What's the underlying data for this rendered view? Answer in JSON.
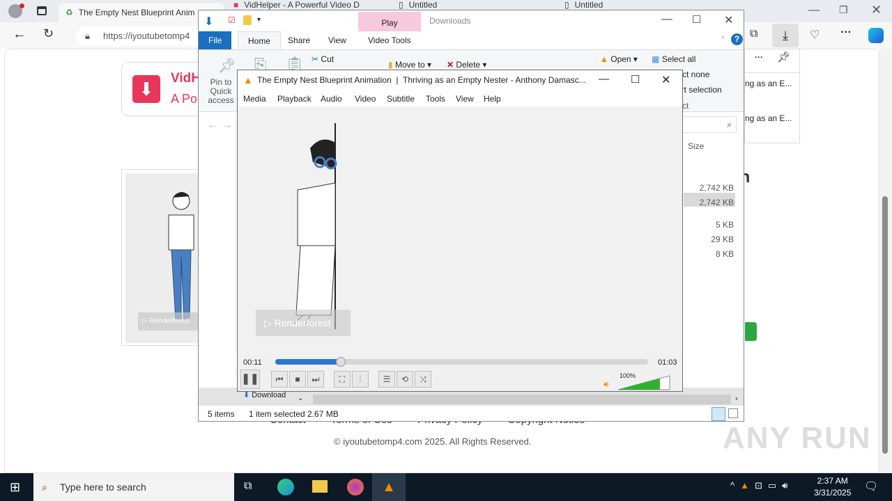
{
  "browser": {
    "tabs": [
      {
        "title": "The Empty Nest Blueprint Anim",
        "active": true
      },
      {
        "title": "VidHelper - A Powerful Video D",
        "active": false
      },
      {
        "title": "Untitled",
        "active": false
      },
      {
        "title": "Untitled",
        "active": false
      }
    ],
    "url": "https://iyoutubetomp4",
    "downloads_flyout": {
      "items": [
        "ng as an E...",
        "ng as an E..."
      ]
    }
  },
  "website": {
    "brand_title": "VidH",
    "brand_subtitle": "A Po",
    "heading_fragment": "on",
    "watermark_text": "Renderforest",
    "footer_links": [
      "Contact",
      "Terms of Use",
      "Privacy Policy",
      "Copyright Notice"
    ],
    "copyright": "© iyoutubetomp4.com 2025. All Rights Reserved."
  },
  "explorer": {
    "title": "Downloads",
    "context_tab": "Play",
    "tabs": [
      "File",
      "Home",
      "Share",
      "View",
      "Video Tools"
    ],
    "ribbon": {
      "pin": "Pin to Quick access",
      "cut": "Cut",
      "move_to": "Move to",
      "delete": "Delete",
      "open": "Open",
      "select_all": "Select all",
      "select_none": "Select none",
      "invert_selection": "Invert selection",
      "select": "Select"
    },
    "column_size": "Size",
    "sizes": [
      "2,742 KB",
      "2,742 KB",
      "5 KB",
      "29 KB",
      "8 KB"
    ],
    "nav_item": "Download",
    "status_items": "5 items",
    "status_selected": "1 item selected  2.67 MB"
  },
  "vlc": {
    "title": "The Empty Nest Blueprint Animation  |  Thriving as an Empty Nester - Anthony Damasc...",
    "menu": [
      "Media",
      "Playback",
      "Audio",
      "Video",
      "Subtitle",
      "Tools",
      "View",
      "Help"
    ],
    "elapsed": "00:11",
    "total": "01:03",
    "progress_fraction": 0.175,
    "volume": "100%",
    "volume_fraction": 1.0,
    "watermark": "Renderforest"
  },
  "taskbar": {
    "search_placeholder": "Type here to search",
    "time": "2:37 AM",
    "date": "3/31/2025"
  },
  "anyrun": "ANY RUN",
  "colors": {
    "accent_blue": "#1a6fc0",
    "vlc_orange": "#f08a00",
    "brand_red": "#e8365b",
    "volume_green": "#2fb12f"
  }
}
